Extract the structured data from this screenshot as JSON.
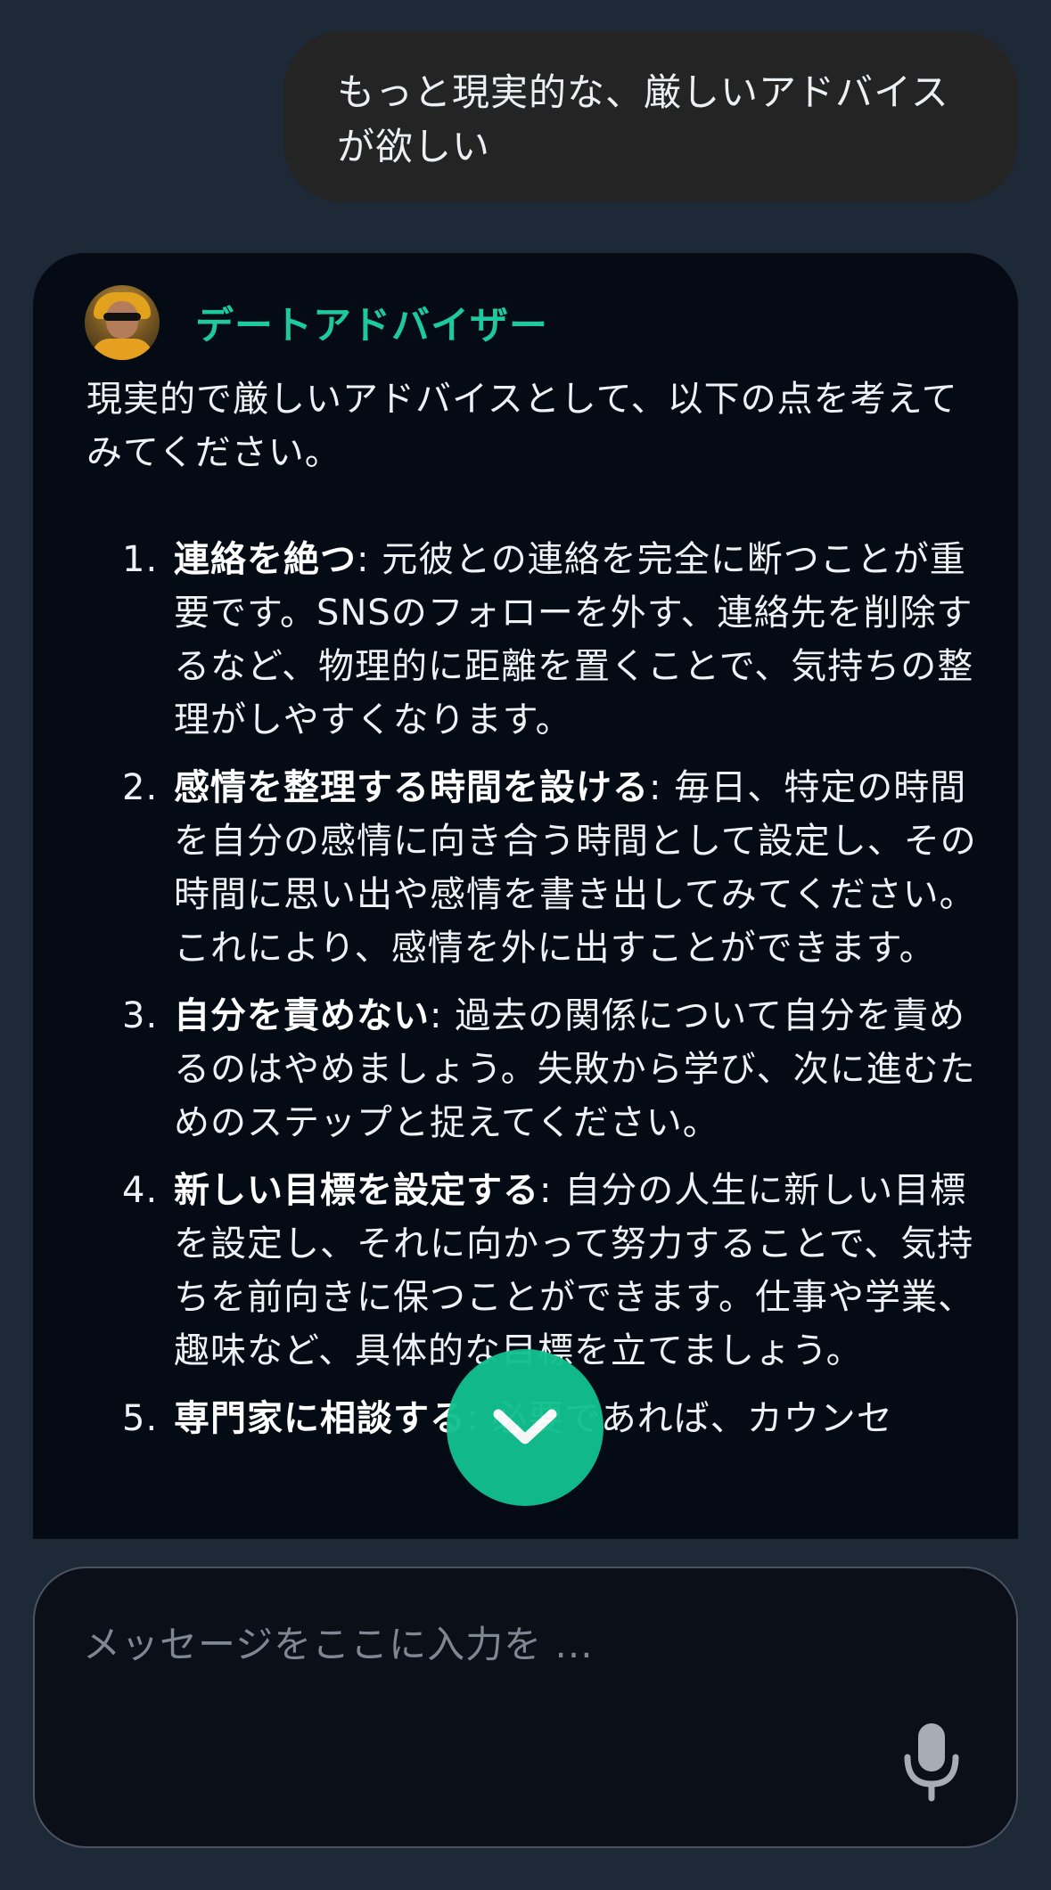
{
  "user_message": {
    "text": "もっと現実的な、厳しいアドバイスが欲しい"
  },
  "assistant_message": {
    "name": "デートアドバイザー",
    "intro": "現実的で厳しいアドバイスとして、以下の点を考えてみてください。",
    "items": [
      {
        "number": "1.",
        "title": "連絡を絶つ",
        "text": ": 元彼との連絡を完全に断つことが重要です。SNSのフォローを外す、連絡先を削除するなど、物理的に距離を置くことで、気持ちの整理がしやすくなります。"
      },
      {
        "number": "2.",
        "title": "感情を整理する時間を設ける",
        "text": ": 毎日、特定の時間を自分の感情に向き合う時間として設定し、その時間に思い出や感情を書き出してみてください。これにより、感情を外に出すことができます。"
      },
      {
        "number": "3.",
        "title": "自分を責めない",
        "text": ": 過去の関係について自分を責めるのはやめましょう。失敗から学び、次に進むためのステップと捉えてください。"
      },
      {
        "number": "4.",
        "title": "新しい目標を設定する",
        "text": ": 自分の人生に新しい目標を設定し、それに向かって努力することで、気持ちを前向きに保つことができます。仕事や学業、趣味など、具体的な目標を立てましょう。"
      },
      {
        "number": "5.",
        "title": "専門家に相談する",
        "text": ": 必要であれば、カウンセ"
      }
    ]
  },
  "input": {
    "placeholder": "メッセージをここに入力を ..."
  },
  "icons": {
    "scroll_down": "chevron-down-icon",
    "mic": "microphone-icon",
    "avatar": "advisor-avatar"
  },
  "colors": {
    "background": "#1e2938",
    "user_bubble": "#242424",
    "assistant_card": "#050b14",
    "accent": "#1ec9a0",
    "scroll_button": "#12c08f"
  }
}
